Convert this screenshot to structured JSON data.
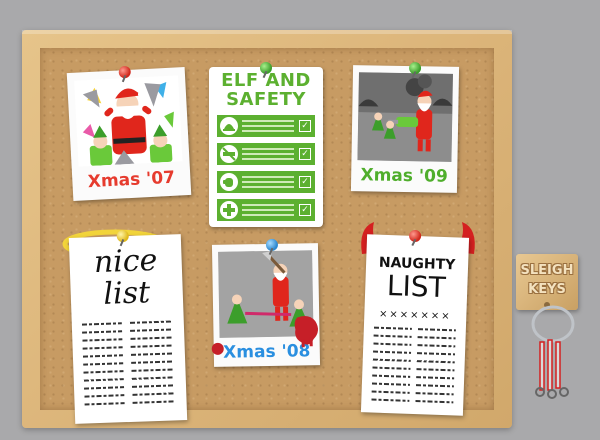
{
  "polaroids": {
    "xmas07": {
      "caption": "Xmas '07",
      "caption_color": "#e63b2e"
    },
    "xmas09": {
      "caption": "Xmas '09",
      "caption_color": "#4fae2c"
    },
    "xmas08": {
      "caption": "Xmas '08",
      "caption_color": "#2a8fe0"
    }
  },
  "safety_sign": {
    "title_line1": "ELF AND",
    "title_line2": "SAFETY",
    "color": "#5cb030",
    "rows": [
      {
        "icon": "hardhat-icon",
        "check": "✓"
      },
      {
        "icon": "no-chainsaw-icon",
        "check": "✓"
      },
      {
        "icon": "glove-icon",
        "check": "✓"
      },
      {
        "icon": "first-aid-icon",
        "check": "✓"
      }
    ]
  },
  "nice_list": {
    "line1": "nice",
    "line2": "list"
  },
  "naughty_list": {
    "line1": "NAUGHTY",
    "line2": "LIST",
    "divider": "×××××××"
  },
  "sleigh_keys": {
    "line1": "SLEIGH",
    "line2": "KEYS"
  }
}
